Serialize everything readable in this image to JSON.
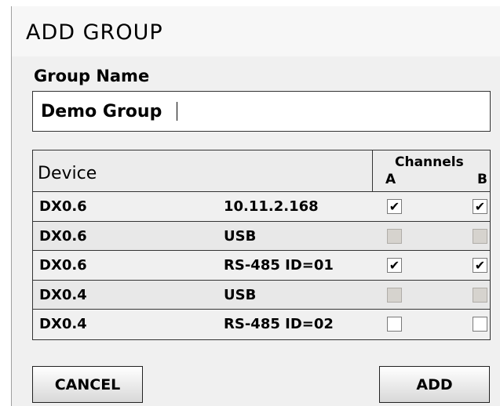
{
  "dialog": {
    "title": "ADD GROUP",
    "group_name_label": "Group Name",
    "group_name_value": "Demo Group"
  },
  "table": {
    "header_device": "Device",
    "header_channels": "Channels",
    "header_a": "A",
    "header_b": "B",
    "rows": [
      {
        "device": "DX0.6",
        "connection": "10.11.2.168",
        "a": "checked",
        "b": "checked",
        "a_mark": "✔",
        "b_mark": "✔"
      },
      {
        "device": "DX0.6",
        "connection": "USB",
        "a": "disabled",
        "b": "disabled",
        "a_mark": "",
        "b_mark": ""
      },
      {
        "device": "DX0.6",
        "connection": "RS-485 ID=01",
        "a": "checked",
        "b": "checked",
        "a_mark": "✔",
        "b_mark": "✔"
      },
      {
        "device": "DX0.4",
        "connection": "USB",
        "a": "disabled",
        "b": "disabled",
        "a_mark": "",
        "b_mark": ""
      },
      {
        "device": "DX0.4",
        "connection": "RS-485 ID=02",
        "a": "unchecked",
        "b": "unchecked",
        "a_mark": "",
        "b_mark": ""
      }
    ]
  },
  "buttons": {
    "cancel_label": "CANCEL",
    "add_label": "ADD"
  }
}
